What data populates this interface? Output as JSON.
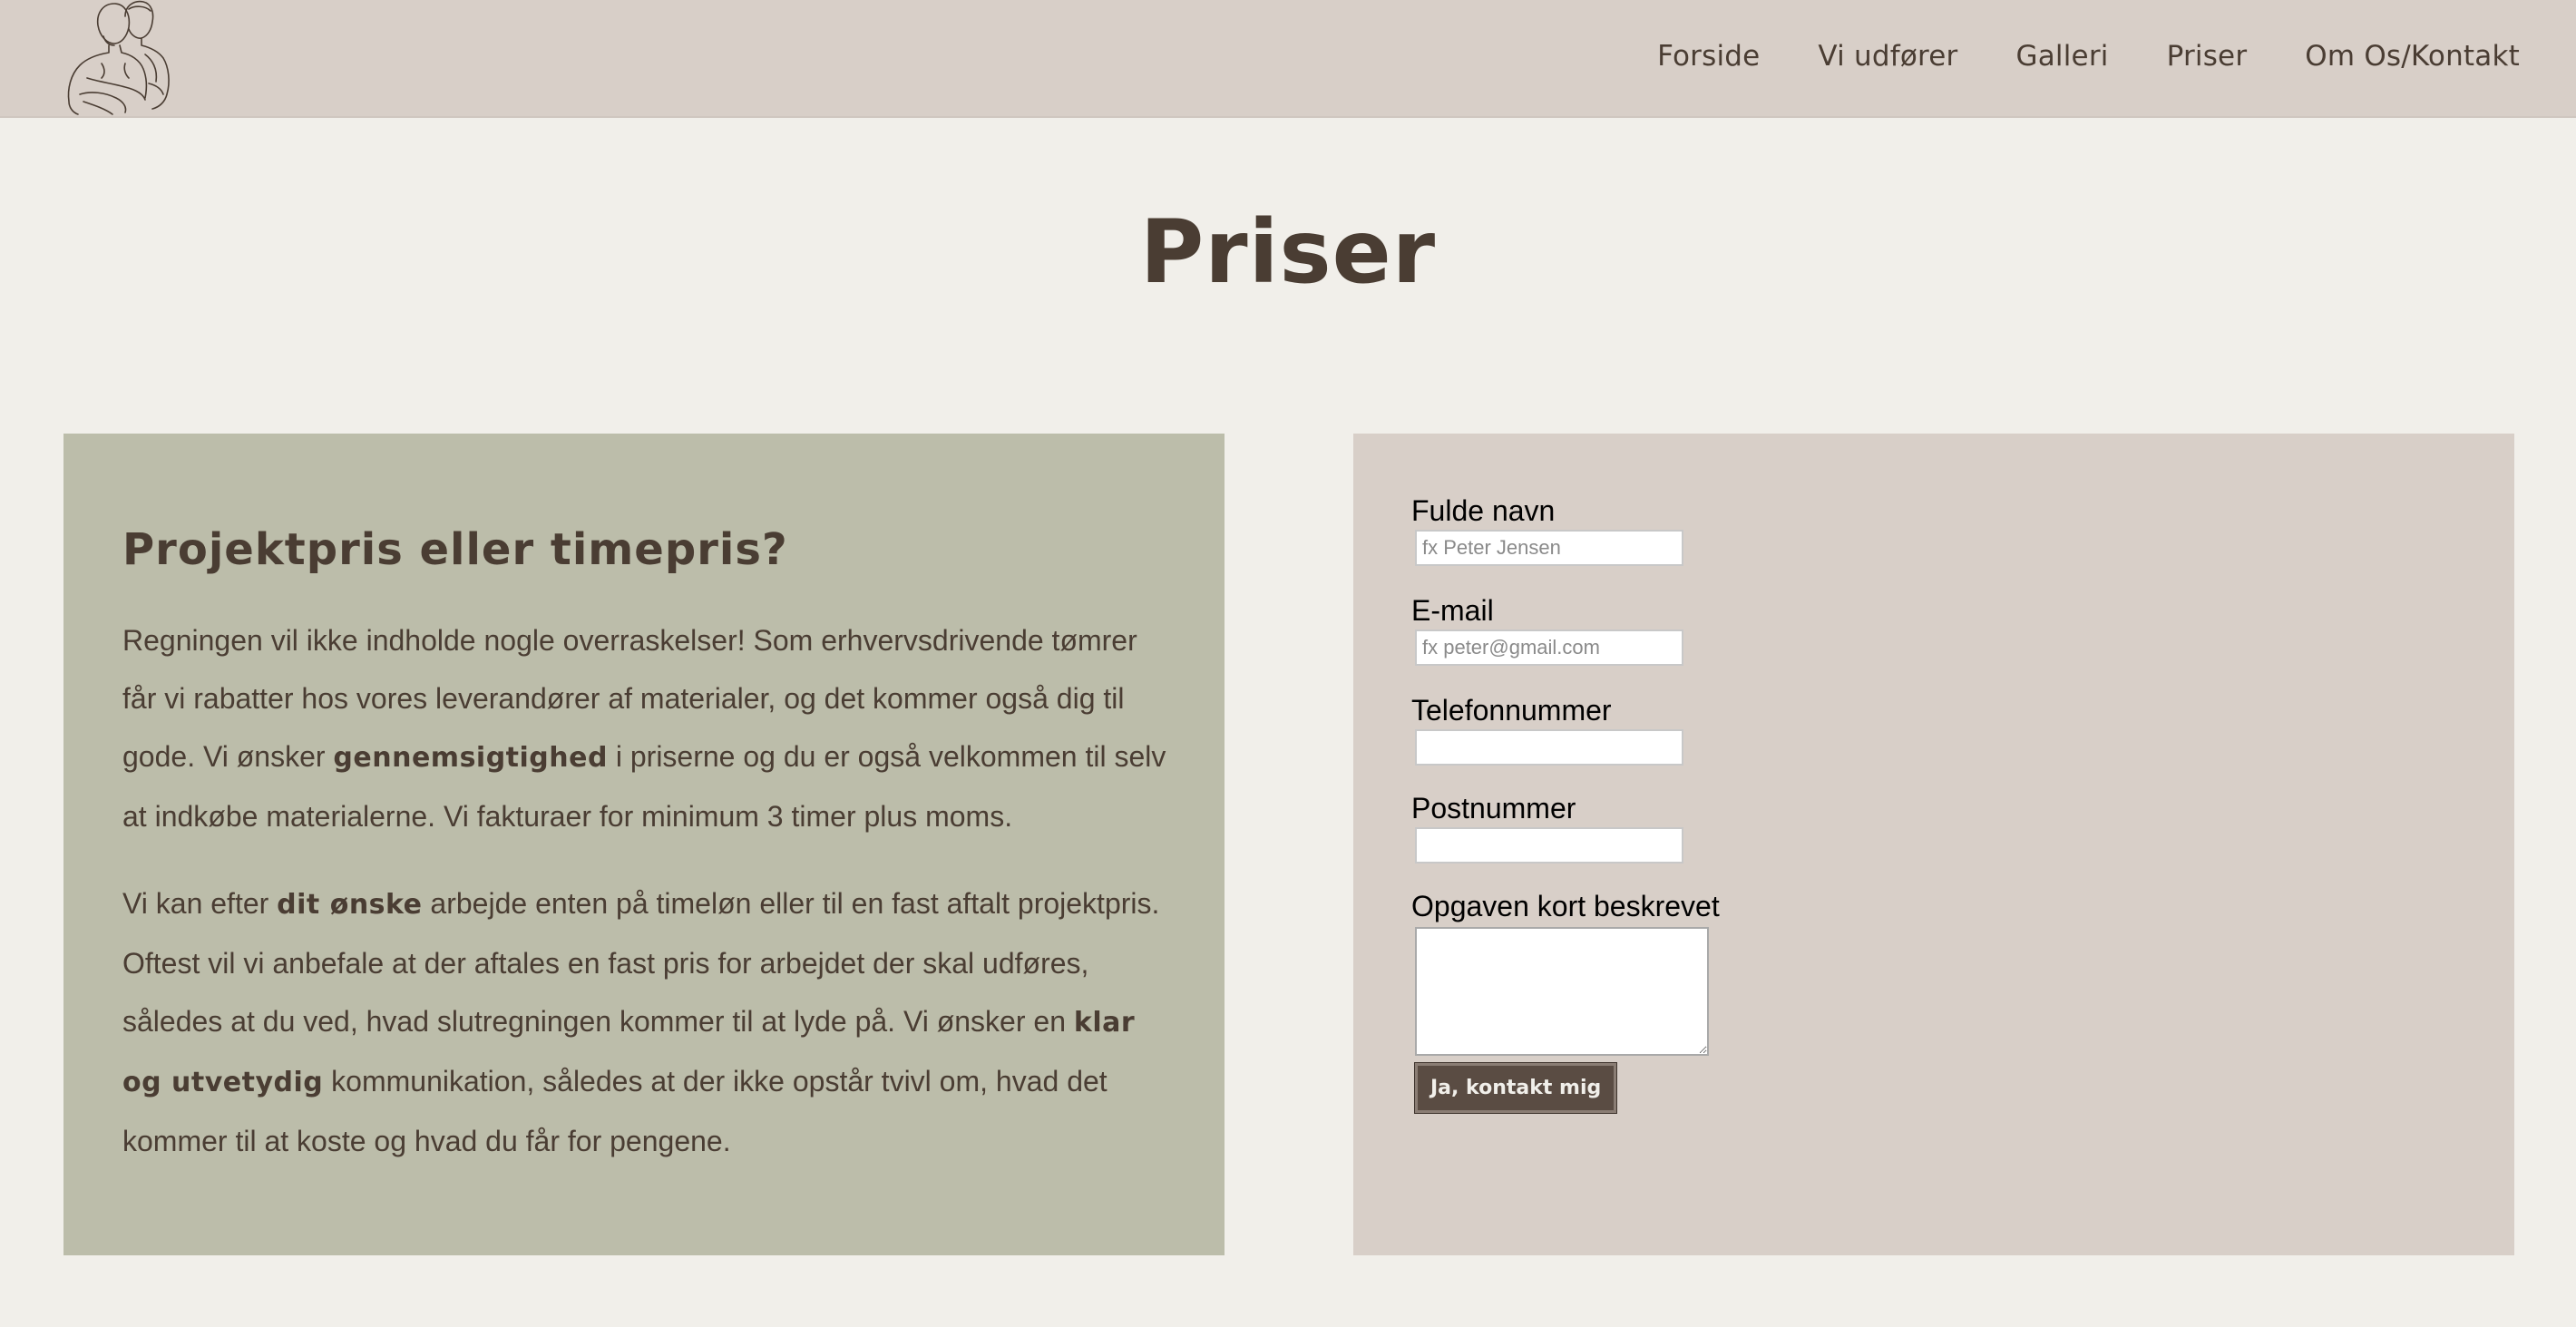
{
  "nav": {
    "items": [
      "Forside",
      "Vi udfører",
      "Galleri",
      "Priser",
      "Om Os/Kontakt"
    ]
  },
  "page": {
    "title": "Priser"
  },
  "info": {
    "heading": "Projektpris eller timepris?",
    "p1": {
      "part1": "Regningen vil ikke indholde nogle overraskelser! Som erhvervsdrivende tømrer får vi rabatter hos vores leverandører af materialer, og det kommer også dig til gode. Vi ønsker ",
      "bold1": "gennemsigtighed",
      "part2": " i priserne og du er også velkommen til selv at indkøbe materialerne. Vi fakturaer for minimum 3 timer plus moms."
    },
    "p2": {
      "part1": "Vi kan efter ",
      "bold1": "dit ønske",
      "part2": " arbejde enten på timeløn eller til en fast aftalt projektpris. Oftest vil vi anbefale at der aftales en fast pris for arbejdet der skal udføres, således at du ved, hvad slutregningen kommer til at lyde på. Vi ønsker en ",
      "bold2": "klar og utvetydig",
      "part3": " kommunikation, således at der ikke opstår tvivl om, hvad det kommer til at koste og hvad du får for pengene."
    }
  },
  "form": {
    "name_label": "Fulde navn",
    "name_placeholder": "fx Peter Jensen",
    "email_label": "E-mail",
    "email_placeholder": "fx peter@gmail.com",
    "phone_label": "Telefonnummer",
    "zip_label": "Postnummer",
    "task_label": "Opgaven kort beskrevet",
    "submit_label": "Ja, kontakt mig"
  },
  "colors": {
    "header_bg": "#d8cfc8",
    "page_bg": "#f1efea",
    "info_bg": "#bcbdaa",
    "text": "#4a3d33",
    "button_bg": "#5a4c43"
  },
  "icons": {
    "logo": "two-carpenters-line-drawing"
  }
}
